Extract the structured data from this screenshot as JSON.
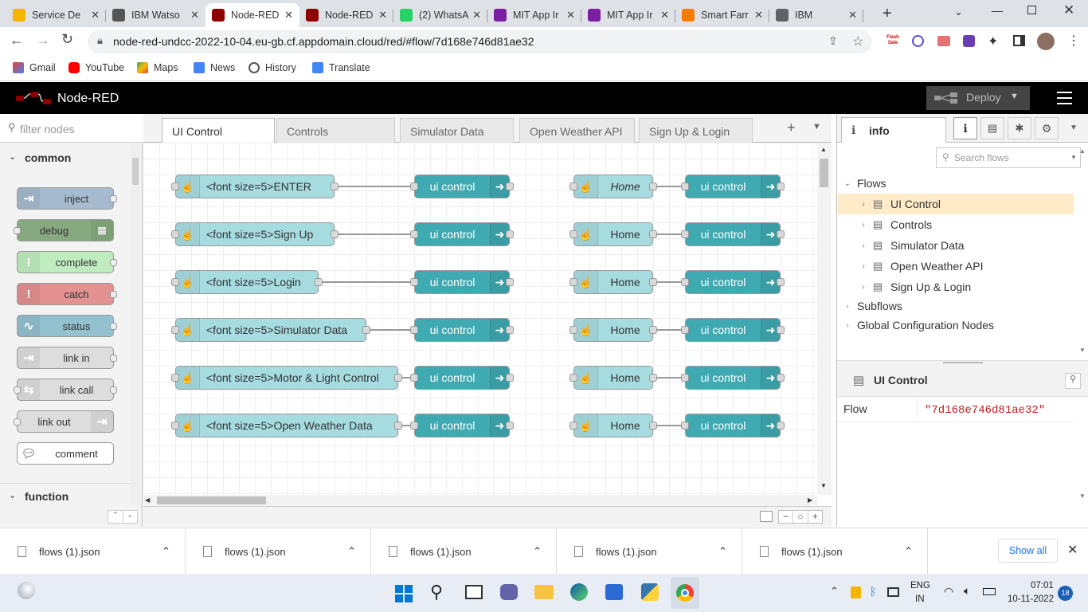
{
  "browser": {
    "tabs": [
      {
        "title": "Service De",
        "color": "#f4b400"
      },
      {
        "title": "IBM Watso",
        "color": "#555555"
      },
      {
        "title": "Node-RED",
        "color": "#8f0000",
        "active": true
      },
      {
        "title": "Node-RED",
        "color": "#8f0000"
      },
      {
        "title": "(2) WhatsA",
        "color": "#25d366"
      },
      {
        "title": "MIT App Ir",
        "color": "#7b1fa2"
      },
      {
        "title": "MIT App Ir",
        "color": "#7b1fa2"
      },
      {
        "title": "Smart Farr",
        "color": "#f57c00"
      },
      {
        "title": "IBM",
        "color": "#5f6368"
      }
    ],
    "url": "node-red-undcc-2022-10-04.eu-gb.cf.appdomain.cloud/red/#flow/7d168e746d81ae32",
    "bookmarks": [
      "Gmail",
      "YouTube",
      "Maps",
      "News",
      "History",
      "Translate"
    ],
    "flash_badge": "Flash Sale"
  },
  "nodered": {
    "title": "Node-RED",
    "deploy_label": "Deploy",
    "palette": {
      "filter_placeholder": "filter nodes",
      "category_common": "common",
      "category_function": "function",
      "nodes": [
        {
          "label": "inject",
          "color": "#a6bbcf"
        },
        {
          "label": "debug",
          "color": "#87a980"
        },
        {
          "label": "complete",
          "color": "#c0edc0"
        },
        {
          "label": "catch",
          "color": "#e49191"
        },
        {
          "label": "status",
          "color": "#94c1d0"
        },
        {
          "label": "link in",
          "color": "#dddddd"
        },
        {
          "label": "link call",
          "color": "#dddddd"
        },
        {
          "label": "link out",
          "color": "#dddddd"
        },
        {
          "label": "comment",
          "color": "#ffffff"
        }
      ]
    },
    "workspace_tabs": [
      "UI Control",
      "Controls",
      "Simulator Data",
      "Open Weather API",
      "Sign Up & Login"
    ],
    "flow_rows": [
      {
        "inject": "<font size=5>ENTER",
        "out": "ui control",
        "home": "Home",
        "home_italic": true,
        "out2": "ui control"
      },
      {
        "inject": "<font size=5>Sign Up",
        "out": "ui control",
        "home": "Home",
        "out2": "ui control"
      },
      {
        "inject": "<font size=5>Login",
        "out": "ui control",
        "home": "Home",
        "out2": "ui control"
      },
      {
        "inject": "<font size=5>Simulator Data",
        "out": "ui control",
        "home": "Home",
        "out2": "ui control"
      },
      {
        "inject": "<font size=5>Motor & Light Control",
        "out": "ui control",
        "home": "Home",
        "out2": "ui control"
      },
      {
        "inject": "<font size=5>Open Weather Data",
        "out": "ui control",
        "home": "Home",
        "out2": "ui control"
      }
    ],
    "sidebar": {
      "tab_label": "info",
      "search_placeholder": "Search flows",
      "flows_label": "Flows",
      "flows": [
        "UI Control",
        "Controls",
        "Simulator Data",
        "Open Weather API",
        "Sign Up & Login"
      ],
      "subflows_label": "Subflows",
      "global_label": "Global Configuration Nodes",
      "info_title": "UI Control",
      "prop_key": "Flow",
      "prop_value": "\"7d168e746d81ae32\""
    }
  },
  "downloads": {
    "files": [
      "flows (1).json",
      "flows (1).json",
      "flows (1).json",
      "flows (1).json",
      "flows (1).json"
    ],
    "show_all": "Show all"
  },
  "taskbar": {
    "lang": "ENG",
    "region": "IN",
    "time": "07:01",
    "date": "10-11-2022",
    "notif_count": "18"
  }
}
